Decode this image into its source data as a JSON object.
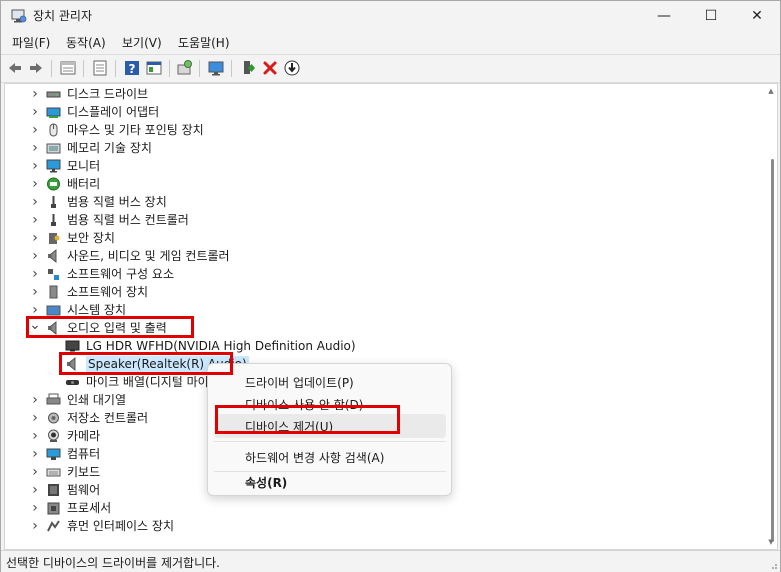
{
  "window": {
    "title": "장치 관리자",
    "minimize_glyph": "—",
    "maximize_glyph": "☐",
    "close_glyph": "✕"
  },
  "menu": [
    "파일(F)",
    "동작(A)",
    "보기(V)",
    "도움말(H)"
  ],
  "toolbar": [
    "back-icon",
    "forward-icon",
    "properties-view-icon",
    "document-icon",
    "help-icon",
    "properties-icon",
    "scan-icon",
    "monitor-icon",
    "enable-driver-icon",
    "remove-icon",
    "download-icon"
  ],
  "tree": {
    "items": [
      {
        "label": "디스크 드라이브",
        "icon": "disk-drive-icon",
        "expanded": false,
        "level": 0
      },
      {
        "label": "디스플레이 어댑터",
        "icon": "display-adapter-icon",
        "expanded": false,
        "level": 0
      },
      {
        "label": "마우스 및 기타 포인팅 장치",
        "icon": "mouse-icon",
        "expanded": false,
        "level": 0
      },
      {
        "label": "메모리 기술 장치",
        "icon": "memory-icon",
        "expanded": false,
        "level": 0
      },
      {
        "label": "모니터",
        "icon": "monitor-icon",
        "expanded": false,
        "level": 0
      },
      {
        "label": "배터리",
        "icon": "battery-icon",
        "expanded": false,
        "level": 0
      },
      {
        "label": "범용 직렬 버스 장치",
        "icon": "usb-icon",
        "expanded": false,
        "level": 0
      },
      {
        "label": "범용 직렬 버스 컨트롤러",
        "icon": "usb-controller-icon",
        "expanded": false,
        "level": 0
      },
      {
        "label": "보안 장치",
        "icon": "security-icon",
        "expanded": false,
        "level": 0
      },
      {
        "label": "사운드, 비디오 및 게임 컨트롤러",
        "icon": "speaker-icon",
        "expanded": false,
        "level": 0
      },
      {
        "label": "소프트웨어 구성 요소",
        "icon": "software-component-icon",
        "expanded": false,
        "level": 0
      },
      {
        "label": "소프트웨어 장치",
        "icon": "software-device-icon",
        "expanded": false,
        "level": 0
      },
      {
        "label": "시스템 장치",
        "icon": "system-device-icon",
        "expanded": false,
        "level": 0
      },
      {
        "label": "오디오 입력 및 출력",
        "icon": "speaker-icon",
        "expanded": true,
        "level": 0
      },
      {
        "label": "LG HDR WFHD(NVIDIA High Definition Audio)",
        "icon": "monitor-dark-icon",
        "level": 1
      },
      {
        "label": "Speaker(Realtek(R) Audio)",
        "icon": "speaker-icon",
        "level": 1,
        "selected": true
      },
      {
        "label": "마이크 배열(디지털 마이크용 인텔® 스마트 사운드 기술)",
        "icon": "microphone-icon",
        "level": 1
      },
      {
        "label": "인쇄 대기열",
        "icon": "printer-icon",
        "expanded": false,
        "level": 0
      },
      {
        "label": "저장소 컨트롤러",
        "icon": "storage-controller-icon",
        "expanded": false,
        "level": 0
      },
      {
        "label": "카메라",
        "icon": "camera-icon",
        "expanded": false,
        "level": 0
      },
      {
        "label": "컴퓨터",
        "icon": "computer-icon",
        "expanded": false,
        "level": 0
      },
      {
        "label": "키보드",
        "icon": "keyboard-icon",
        "expanded": false,
        "level": 0
      },
      {
        "label": "펌웨어",
        "icon": "firmware-icon",
        "expanded": false,
        "level": 0
      },
      {
        "label": "프로세서",
        "icon": "processor-icon",
        "expanded": false,
        "level": 0
      },
      {
        "label": "휴먼 인터페이스 장치",
        "icon": "hid-icon",
        "expanded": false,
        "level": 0
      }
    ]
  },
  "context_menu": {
    "items": [
      "드라이버 업데이트(P)",
      "디바이스 사용 안 함(D)",
      "디바이스 제거(U)",
      "하드웨어 변경 사항 검색(A)",
      "속성(R)"
    ]
  },
  "status": {
    "text": "선택한 디바이스의 드라이버를 제거합니다."
  },
  "colors": {
    "highlight_box": "#e00000",
    "selection": "#cce8ff"
  }
}
